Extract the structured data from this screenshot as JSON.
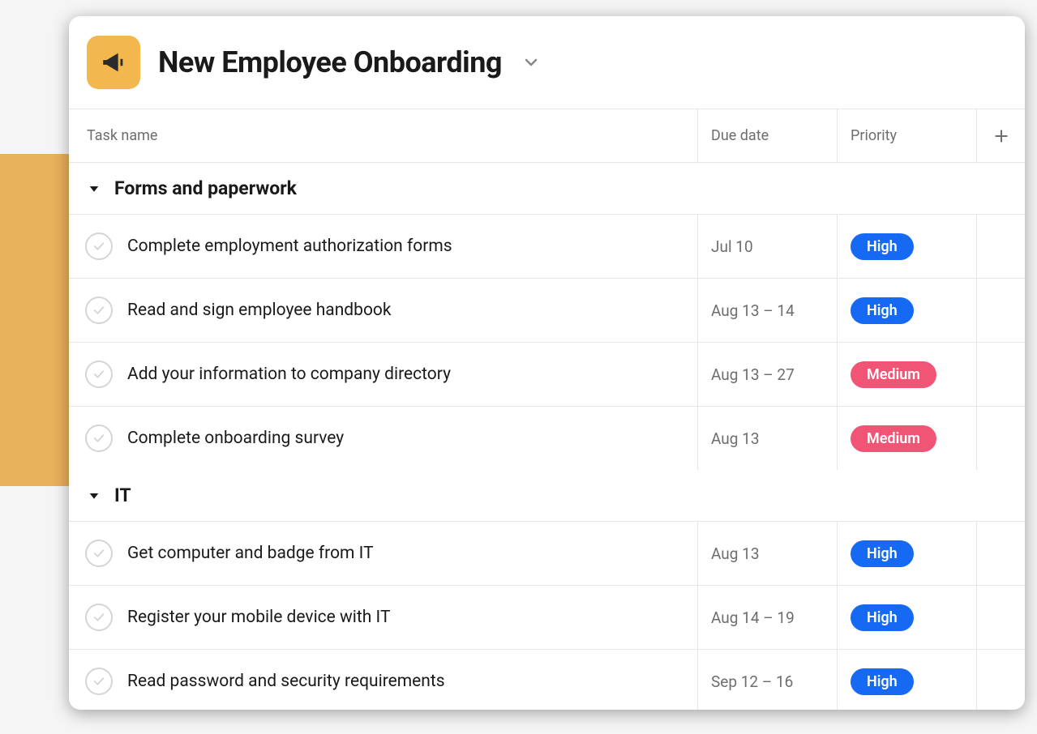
{
  "header": {
    "title": "New Employee Onboarding"
  },
  "columns": {
    "task_name": "Task name",
    "due_date": "Due date",
    "priority": "Priority"
  },
  "priority_labels": {
    "high": "High",
    "medium": "Medium"
  },
  "sections": [
    {
      "title": "Forms and paperwork",
      "tasks": [
        {
          "name": "Complete employment authorization forms",
          "due": "Jul 10",
          "priority": "high"
        },
        {
          "name": "Read and sign employee handbook",
          "due": "Aug 13 – 14",
          "priority": "high"
        },
        {
          "name": "Add your information to company directory",
          "due": "Aug 13 – 27",
          "priority": "medium"
        },
        {
          "name": "Complete onboarding survey",
          "due": "Aug 13",
          "priority": "medium"
        }
      ]
    },
    {
      "title": "IT",
      "tasks": [
        {
          "name": "Get computer and badge from IT",
          "due": "Aug 13",
          "priority": "high"
        },
        {
          "name": "Register your mobile device with IT",
          "due": "Aug 14 – 19",
          "priority": "high"
        },
        {
          "name": "Read password and security requirements",
          "due": "Sep 12 – 16",
          "priority": "high"
        }
      ]
    }
  ]
}
